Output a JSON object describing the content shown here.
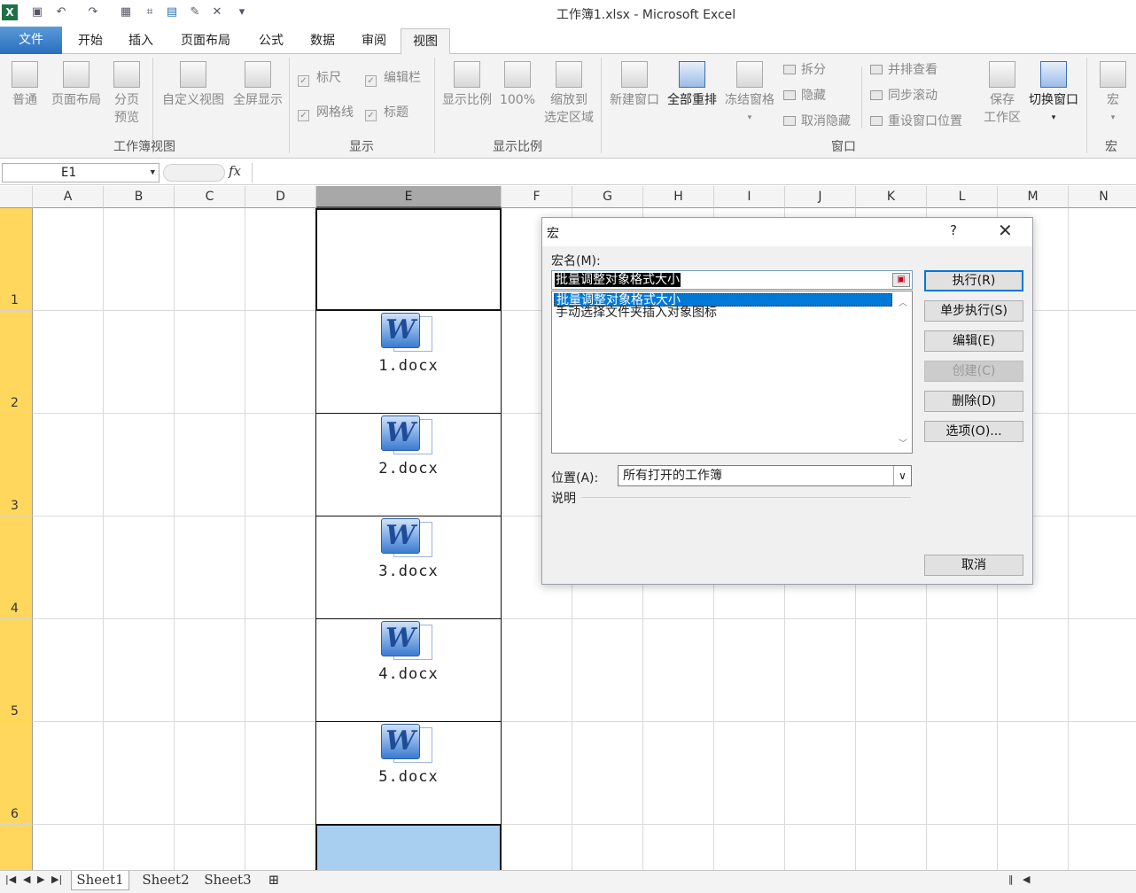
{
  "window": {
    "title": "工作簿1.xlsx - Microsoft Excel"
  },
  "tabs": [
    "文件",
    "开始",
    "插入",
    "页面布局",
    "公式",
    "数据",
    "审阅",
    "视图"
  ],
  "ribbon": {
    "workbook_views": {
      "label": "工作簿视图",
      "normal": "普通",
      "page_layout": "页面布局",
      "page_break_1": "分页",
      "page_break_2": "预览",
      "custom": "自定义视图",
      "fullscreen": "全屏显示"
    },
    "show": {
      "label": "显示",
      "ruler": "标尺",
      "formula_bar": "编辑栏",
      "gridlines": "网格线",
      "headings": "标题"
    },
    "zoom": {
      "label": "显示比例",
      "zoom": "显示比例",
      "hundred": "100%",
      "zoom_sel_1": "缩放到",
      "zoom_sel_2": "选定区域"
    },
    "window": {
      "label": "窗口",
      "new_window": "新建窗口",
      "arrange_all": "全部重排",
      "freeze": "冻结窗格",
      "split": "拆分",
      "hide": "隐藏",
      "unhide": "取消隐藏",
      "side_by_side": "并排查看",
      "sync_scroll": "同步滚动",
      "reset_pos": "重设窗口位置",
      "save_ws_1": "保存",
      "save_ws_2": "工作区",
      "switch": "切换窗口"
    },
    "macros": {
      "label": "宏",
      "macros": "宏"
    }
  },
  "formula_bar": {
    "name_box": "E1",
    "fx": "fx",
    "value": ""
  },
  "columns": [
    "A",
    "B",
    "C",
    "D",
    "E",
    "F",
    "G",
    "H",
    "I",
    "J",
    "K",
    "L",
    "M",
    "N"
  ],
  "rows": [
    "1",
    "2",
    "3",
    "4",
    "5",
    "6"
  ],
  "objects": [
    "1.docx",
    "2.docx",
    "3.docx",
    "4.docx",
    "5.docx"
  ],
  "sheets": [
    "Sheet1",
    "Sheet2",
    "Sheet3"
  ],
  "dialog": {
    "title": "宏",
    "help": "?",
    "macro_name_label": "宏名(M):",
    "macro_name_value": "批量调整对象格式大小",
    "macros": [
      "批量调整对象格式大小",
      "手动选择文件夹插入对象图标"
    ],
    "selected_index": 0,
    "buttons": {
      "run": "执行(R)",
      "step": "单步执行(S)",
      "edit": "编辑(E)",
      "create": "创建(C)",
      "delete": "删除(D)",
      "options": "选项(O)...",
      "cancel": "取消"
    },
    "location_label": "位置(A):",
    "location_value": "所有打开的工作簿",
    "description_label": "说明"
  },
  "colors": {
    "file_tab": "#2a6fbd",
    "row_header_highlight": "#ffd75c",
    "selected_listitem": "#0078d7",
    "active_cell_fill": "#a8cef0"
  }
}
